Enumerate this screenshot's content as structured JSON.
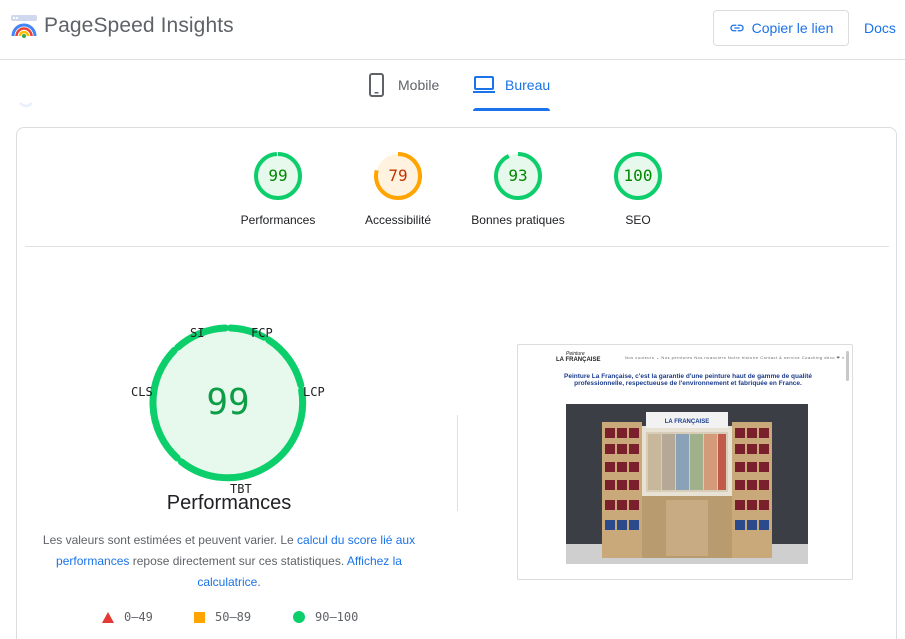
{
  "header": {
    "app_title": "PageSpeed Insights",
    "copy_link_label": "Copier le lien",
    "docs_label": "Docs"
  },
  "tabs": [
    {
      "label": "Mobile",
      "icon": "smartphone-icon",
      "selected": false
    },
    {
      "label": "Bureau",
      "icon": "laptop-icon",
      "selected": true
    }
  ],
  "categories": [
    {
      "score": "99",
      "label": "Performances",
      "status": "pass",
      "fraction": 0.99
    },
    {
      "score": "79",
      "label": "Accessibilité",
      "status": "average",
      "fraction": 0.79
    },
    {
      "score": "93",
      "label": "Bonnes pratiques",
      "status": "pass",
      "fraction": 0.93
    },
    {
      "score": "100",
      "label": "SEO",
      "status": "pass",
      "fraction": 1.0
    }
  ],
  "performance": {
    "score": "99",
    "title": "Performances",
    "metrics": [
      "SI",
      "FCP",
      "LCP",
      "TBT",
      "CLS"
    ],
    "note_text_1": "Les valeurs sont estimées et peuvent varier. Le ",
    "note_link_1": "calcul du score lié aux performances",
    "note_text_2": " repose directement sur ces statistiques. ",
    "note_link_2": "Affichez la calculatrice",
    "note_text_3": "."
  },
  "legend": [
    {
      "range": "0–49",
      "shape": "triangle",
      "color": "#e53935"
    },
    {
      "range": "50–89",
      "shape": "square",
      "color": "#ffa400"
    },
    {
      "range": "90–100",
      "shape": "circle",
      "color": "#0cce6b"
    }
  ],
  "screenshot": {
    "logo_top": "Peinture",
    "logo_bottom": "LA FRANÇAISE",
    "nav_items": "Nos couleurs ⌄   Nos peintures   Nos nuanciers   Notre histoire   Contact & service   Coaching déco   ❤   ⌕",
    "headline": "Peinture La Française, c'est la garantie d'une peinture haut de gamme de qualité professionnelle, respectueuse de l'environnement et fabriquée en France.",
    "display_sign": "LA FRANÇAISE"
  },
  "colors": {
    "pass": "#0cce6b",
    "pass_text": "#008800",
    "pass_fill": "#e7f8ed",
    "average": "#ffa400",
    "average_text": "#c33300",
    "average_fill": "#fff3e0",
    "accent": "#1a73e8"
  }
}
